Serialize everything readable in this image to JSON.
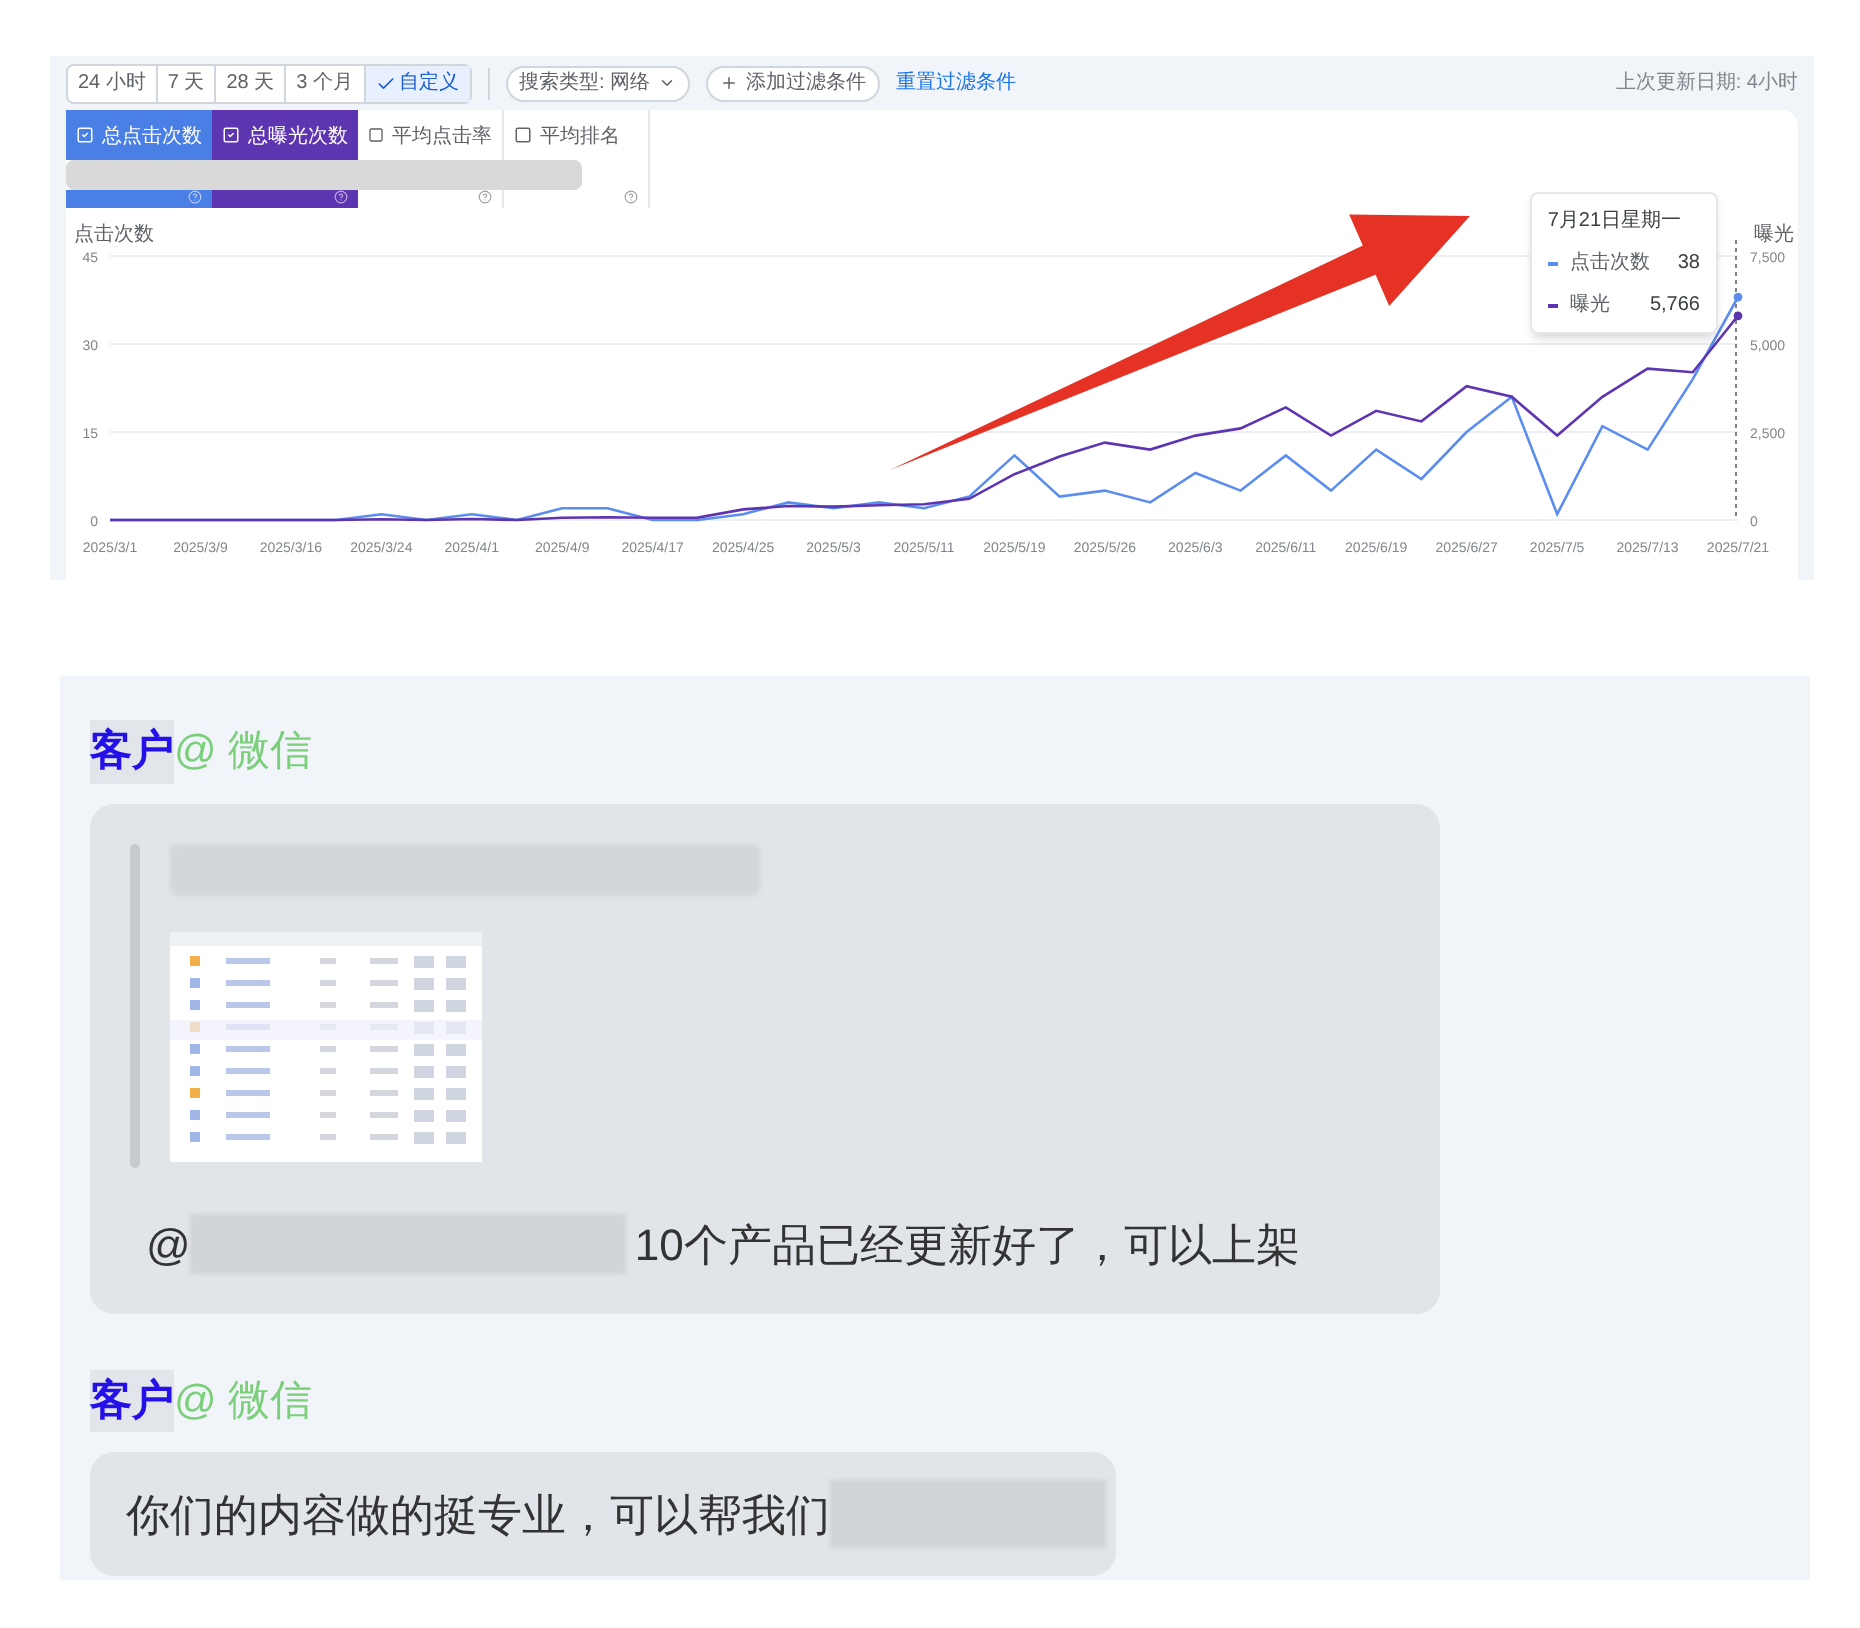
{
  "toolbar": {
    "date_ranges": [
      {
        "label": "24 小时",
        "selected": false
      },
      {
        "label": "7 天",
        "selected": false
      },
      {
        "label": "28 天",
        "selected": false
      },
      {
        "label": "3 个月",
        "selected": false
      },
      {
        "label": "自定义",
        "selected": true
      }
    ],
    "search_type": "搜索类型: 网络",
    "add_filter": "添加过滤条件",
    "reset_filter": "重置过滤条件",
    "last_updated": "上次更新日期: 4小时"
  },
  "metric_cards": [
    {
      "label": "总点击次数",
      "selected": true,
      "color": "#4a7fe6"
    },
    {
      "label": "总曝光次数",
      "selected": true,
      "color": "#5e35b1"
    },
    {
      "label": "平均点击率",
      "selected": false,
      "color": "#ffffff"
    },
    {
      "label": "平均排名",
      "selected": false,
      "color": "#ffffff"
    }
  ],
  "chart": {
    "tooltip": {
      "title": "7月21日星期一",
      "values": [
        "38",
        "5,766"
      ]
    },
    "clicks": {
      "chart_data": {
        "type": "line",
        "ylabel": "点击次数",
        "ylim": [
          0,
          45
        ],
        "yticks": [
          0,
          15,
          30,
          45
        ],
        "categories": [
          "2025/3/1",
          null,
          "2025/3/9",
          null,
          "2025/3/16",
          null,
          "2025/3/24",
          null,
          "2025/4/1",
          null,
          "2025/4/9",
          null,
          "2025/4/17",
          null,
          "2025/4/25",
          null,
          "2025/5/3",
          null,
          "2025/5/11",
          null,
          "2025/5/19",
          null,
          "2025/5/26",
          null,
          "2025/6/3",
          null,
          "2025/6/11",
          null,
          "2025/6/19",
          null,
          "2025/6/27",
          null,
          "2025/7/5",
          null,
          "2025/7/13",
          null,
          "2025/7/21"
        ],
        "series": [
          {
            "name": "点击次数",
            "color": "#5b8def",
            "values": [
              0,
              0,
              0,
              0,
              0,
              0,
              1,
              0,
              1,
              0,
              2,
              2,
              0,
              0,
              1,
              3,
              2,
              3,
              2,
              4,
              11,
              4,
              5,
              3,
              8,
              5,
              11,
              5,
              12,
              7,
              15,
              21,
              1,
              16,
              12,
              24,
              38
            ]
          }
        ]
      }
    },
    "impressions": {
      "chart_data": {
        "type": "line",
        "ylabel": "曝光",
        "ylim": [
          0,
          7500
        ],
        "yticks": [
          {
            "value": 0,
            "label": "0"
          },
          {
            "value": 2500,
            "label": "2,500"
          },
          {
            "value": 5000,
            "label": "5,000"
          },
          {
            "value": 7500,
            "label": "7,500"
          }
        ],
        "categories": [
          null,
          null,
          null,
          null,
          null,
          null,
          null,
          null,
          null,
          null,
          null,
          null,
          null,
          null,
          null,
          null,
          null,
          null,
          null,
          null,
          null,
          null,
          null,
          null,
          null,
          null,
          null,
          null,
          null,
          null,
          null,
          null,
          null,
          null,
          null,
          null,
          null
        ],
        "series": [
          {
            "name": "曝光",
            "color": "#5e35b1",
            "values": [
              0,
              0,
              0,
              0,
              0,
              0,
              20,
              0,
              30,
              0,
              60,
              80,
              60,
              70,
              300,
              400,
              380,
              420,
              450,
              600,
              1300,
              1800,
              2200,
              2000,
              2400,
              2600,
              3200,
              2400,
              3100,
              2800,
              3800,
              3500,
              2400,
              3500,
              4300,
              4200,
              5800
            ]
          }
        ]
      }
    }
  },
  "chat": {
    "messages": [
      {
        "sender": "客户",
        "source": "@ 微信",
        "kind": "quote_reply",
        "mention": "@",
        "text": "10个产品已经更新好了，可以上架"
      },
      {
        "sender": "客户",
        "source": "@ 微信",
        "kind": "plain",
        "text": "你们的内容做的挺专业，可以帮我们"
      }
    ]
  }
}
